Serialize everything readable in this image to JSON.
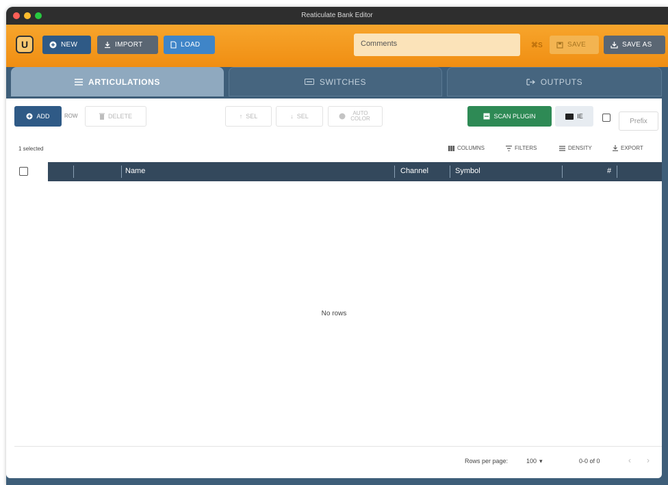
{
  "window": {
    "title": "Reaticulate Bank Editor"
  },
  "toolbar": {
    "logo": "U",
    "new_label": "NEW",
    "import_label": "IMPORT",
    "load_label": "LOAD",
    "comments_placeholder": "Comments",
    "shortcut_label": "⌘S",
    "save_label": "SAVE",
    "save_as_label": "SAVE AS"
  },
  "tabs": [
    {
      "label": "ARTICULATIONS",
      "icon": "list-icon",
      "active": true
    },
    {
      "label": "SWITCHES",
      "icon": "switch-icon",
      "active": false
    },
    {
      "label": "OUTPUTS",
      "icon": "output-icon",
      "active": false
    }
  ],
  "actions": {
    "add_label": "ADD",
    "row_label": "ROW",
    "delete_label": "DELETE",
    "move_up_label": "SEL",
    "move_down_label": "SEL",
    "auto_color_label": "AUTO COLOR",
    "scan_label": "SCAN PLUGIN",
    "view_label": "IE",
    "prefix_placeholder": "Prefix"
  },
  "grid_toolbar": {
    "selected": "1 selected",
    "columns": "COLUMNS",
    "filters": "FILTERS",
    "density": "DENSITY",
    "export": "EXPORT"
  },
  "table": {
    "columns": [
      "Name",
      "Channel",
      "Symbol",
      "#"
    ],
    "empty_message": "No rows"
  },
  "footer": {
    "rows_per_page_label": "Rows per page:",
    "rows_per_page_value": "100",
    "range": "0-0 of 0"
  },
  "colors": {
    "toolbar": "#f39a1e",
    "frame": "#3e5e79",
    "header": "#33485c",
    "scan": "#2e8a55"
  }
}
